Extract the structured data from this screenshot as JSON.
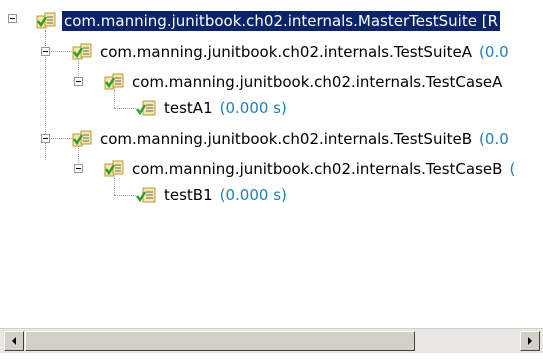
{
  "tree": {
    "nodes": [
      {
        "label": "com.manning.junitbook.ch02.internals.MasterTestSuite [R",
        "time": "",
        "selected": true
      },
      {
        "label": "com.manning.junitbook.ch02.internals.TestSuiteA",
        "time": "(0.0"
      },
      {
        "label": "com.manning.junitbook.ch02.internals.TestCaseA",
        "time": ""
      },
      {
        "label": "testA1",
        "time": "(0.000 s)"
      },
      {
        "label": "com.manning.junitbook.ch02.internals.TestSuiteB",
        "time": "(0.0"
      },
      {
        "label": "com.manning.junitbook.ch02.internals.TestCaseB",
        "time": "("
      },
      {
        "label": "testB1",
        "time": "(0.000 s)"
      }
    ]
  },
  "icons": {
    "suite": "test-suite-passed-icon",
    "test": "test-passed-icon"
  },
  "colors": {
    "selection": "#0a246a",
    "time_text": "#1f7fb8",
    "check": "#2e9e2e"
  }
}
